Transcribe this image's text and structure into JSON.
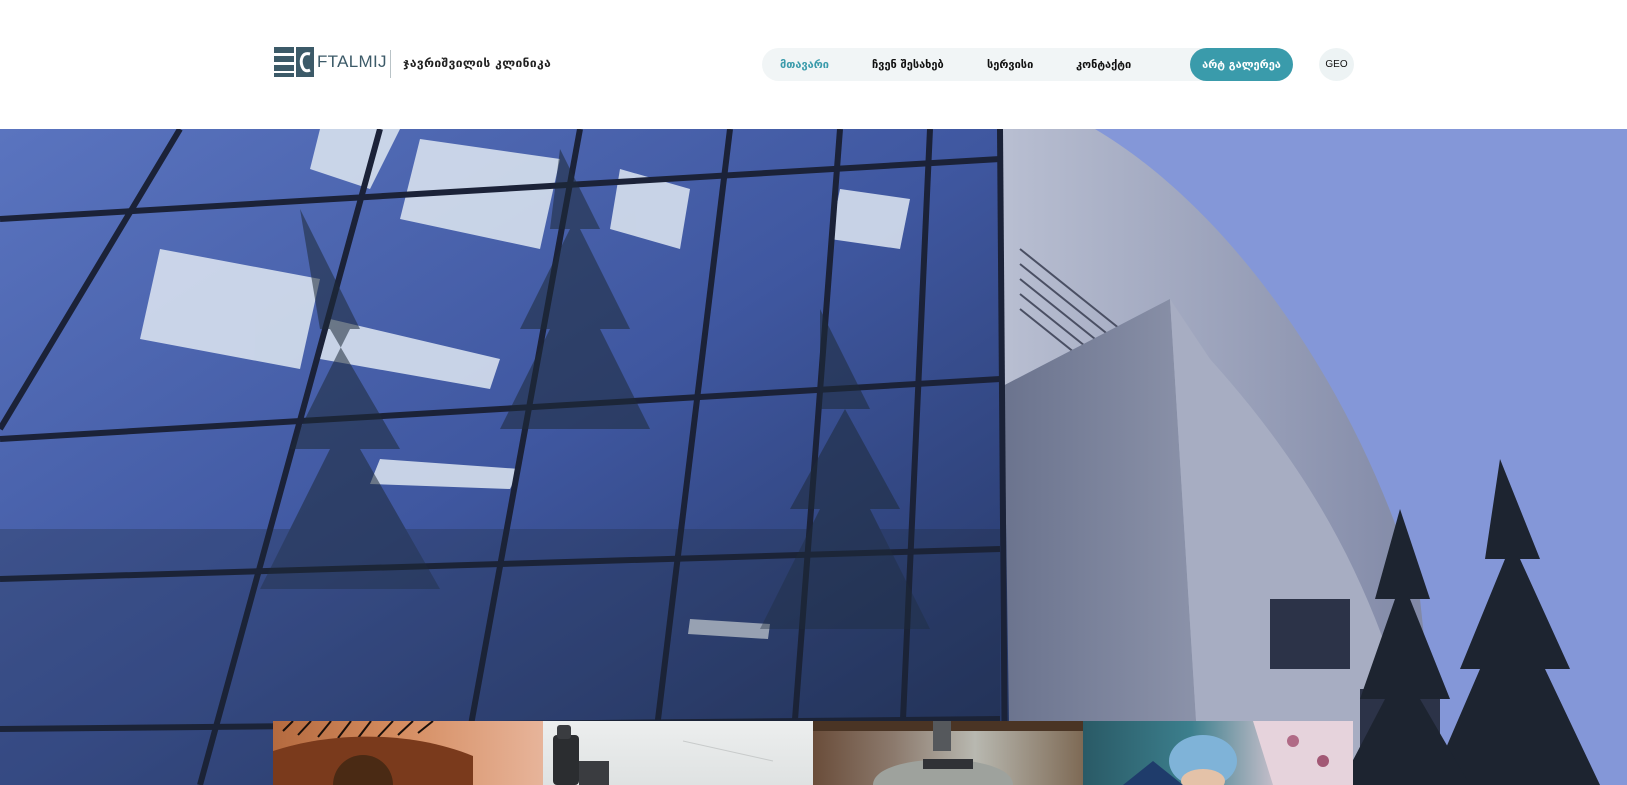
{
  "header": {
    "logo_text": "FTALMIJ",
    "clinic_name": "ჯავრიშვილის კლინიკა"
  },
  "nav": {
    "items": [
      {
        "label": "მთავარი",
        "active": true
      },
      {
        "label": "ჩვენ შესახებ",
        "active": false
      },
      {
        "label": "სერვისი",
        "active": false
      },
      {
        "label": "კონტაქტი",
        "active": false
      }
    ],
    "cta_label": "არტ გალერეა",
    "language": "GEO"
  },
  "hero": {
    "image": "building-photo"
  },
  "thumbnails": [
    {
      "image": "eye-closeup-photo"
    },
    {
      "image": "ophthalmic-device-photo"
    },
    {
      "image": "eye-exam-equipment-photo"
    },
    {
      "image": "surgery-team-photo"
    }
  ],
  "colors": {
    "accent": "#3a9bab",
    "nav_background": "#f1f5f6",
    "logo_color": "#3c5a68"
  }
}
